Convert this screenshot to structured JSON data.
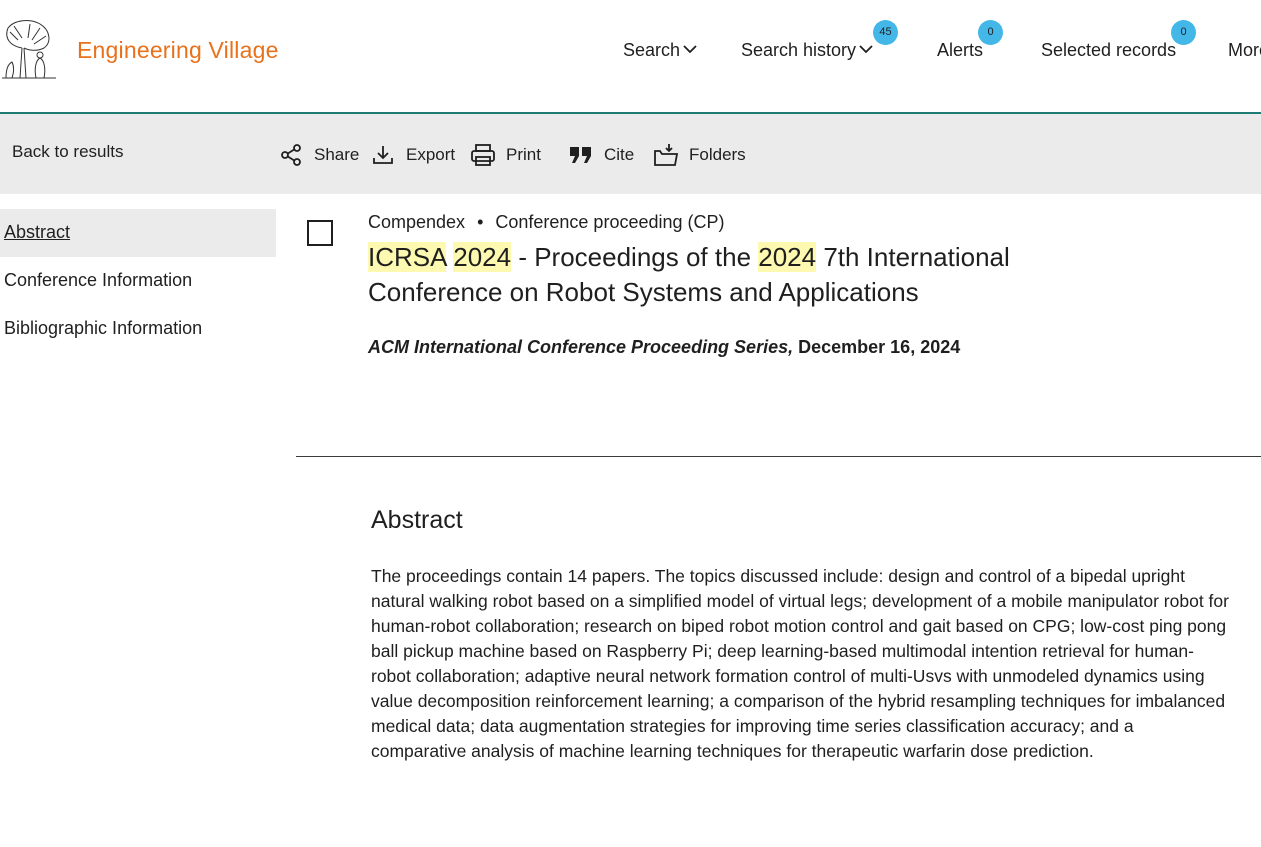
{
  "header": {
    "brand": "Engineering Village",
    "logo_icon": "elsevier-tree-logo",
    "nav": {
      "search": "Search",
      "search_history": "Search history",
      "search_history_count": "45",
      "alerts": "Alerts",
      "alerts_count": "0",
      "selected_records": "Selected records",
      "selected_records_count": "0",
      "more": "More"
    }
  },
  "toolbar": {
    "back": "Back to results",
    "share": "Share",
    "export": "Export",
    "print": "Print",
    "cite": "Cite",
    "folders": "Folders"
  },
  "sidebar": {
    "items": [
      {
        "label": "Abstract",
        "active": true
      },
      {
        "label": "Conference Information",
        "active": false
      },
      {
        "label": "Bibliographic Information",
        "active": false
      }
    ]
  },
  "record": {
    "database": "Compendex",
    "doc_type": "Conference proceeding (CP)",
    "title_parts": [
      "ICRSA",
      " ",
      "2024",
      " - Proceedings of the ",
      "2024",
      " 7th International Conference on Robot Systems and Applications"
    ],
    "series": "ACM International Conference Proceeding Series,",
    "date": "December 16, 2024"
  },
  "abstract": {
    "heading": "Abstract",
    "text": "The proceedings contain 14 papers. The topics discussed include: design and control of a bipedal upright natural walking robot based on a simplified model of virtual legs; development of a mobile manipulator robot for human-robot collaboration; research on biped robot motion control and gait based on CPG; low-cost ping pong ball pickup machine based on Raspberry Pi; deep learning-based multimodal intention retrieval for human-robot collaboration; adaptive neural network formation control of multi-Usvs with unmodeled dynamics using value decomposition reinforcement learning; a comparison of the hybrid resampling techniques for imbalanced medical data; data augmentation strategies for improving time series classification accuracy; and a comparative analysis of machine learning techniques for therapeutic warfarin dose prediction."
  },
  "colors": {
    "brand": "#e9711c",
    "header_rule": "#1e7b74",
    "badge": "#44b7e9",
    "highlight": "#fdf9b0",
    "toolbar_bg": "#ebebeb"
  }
}
